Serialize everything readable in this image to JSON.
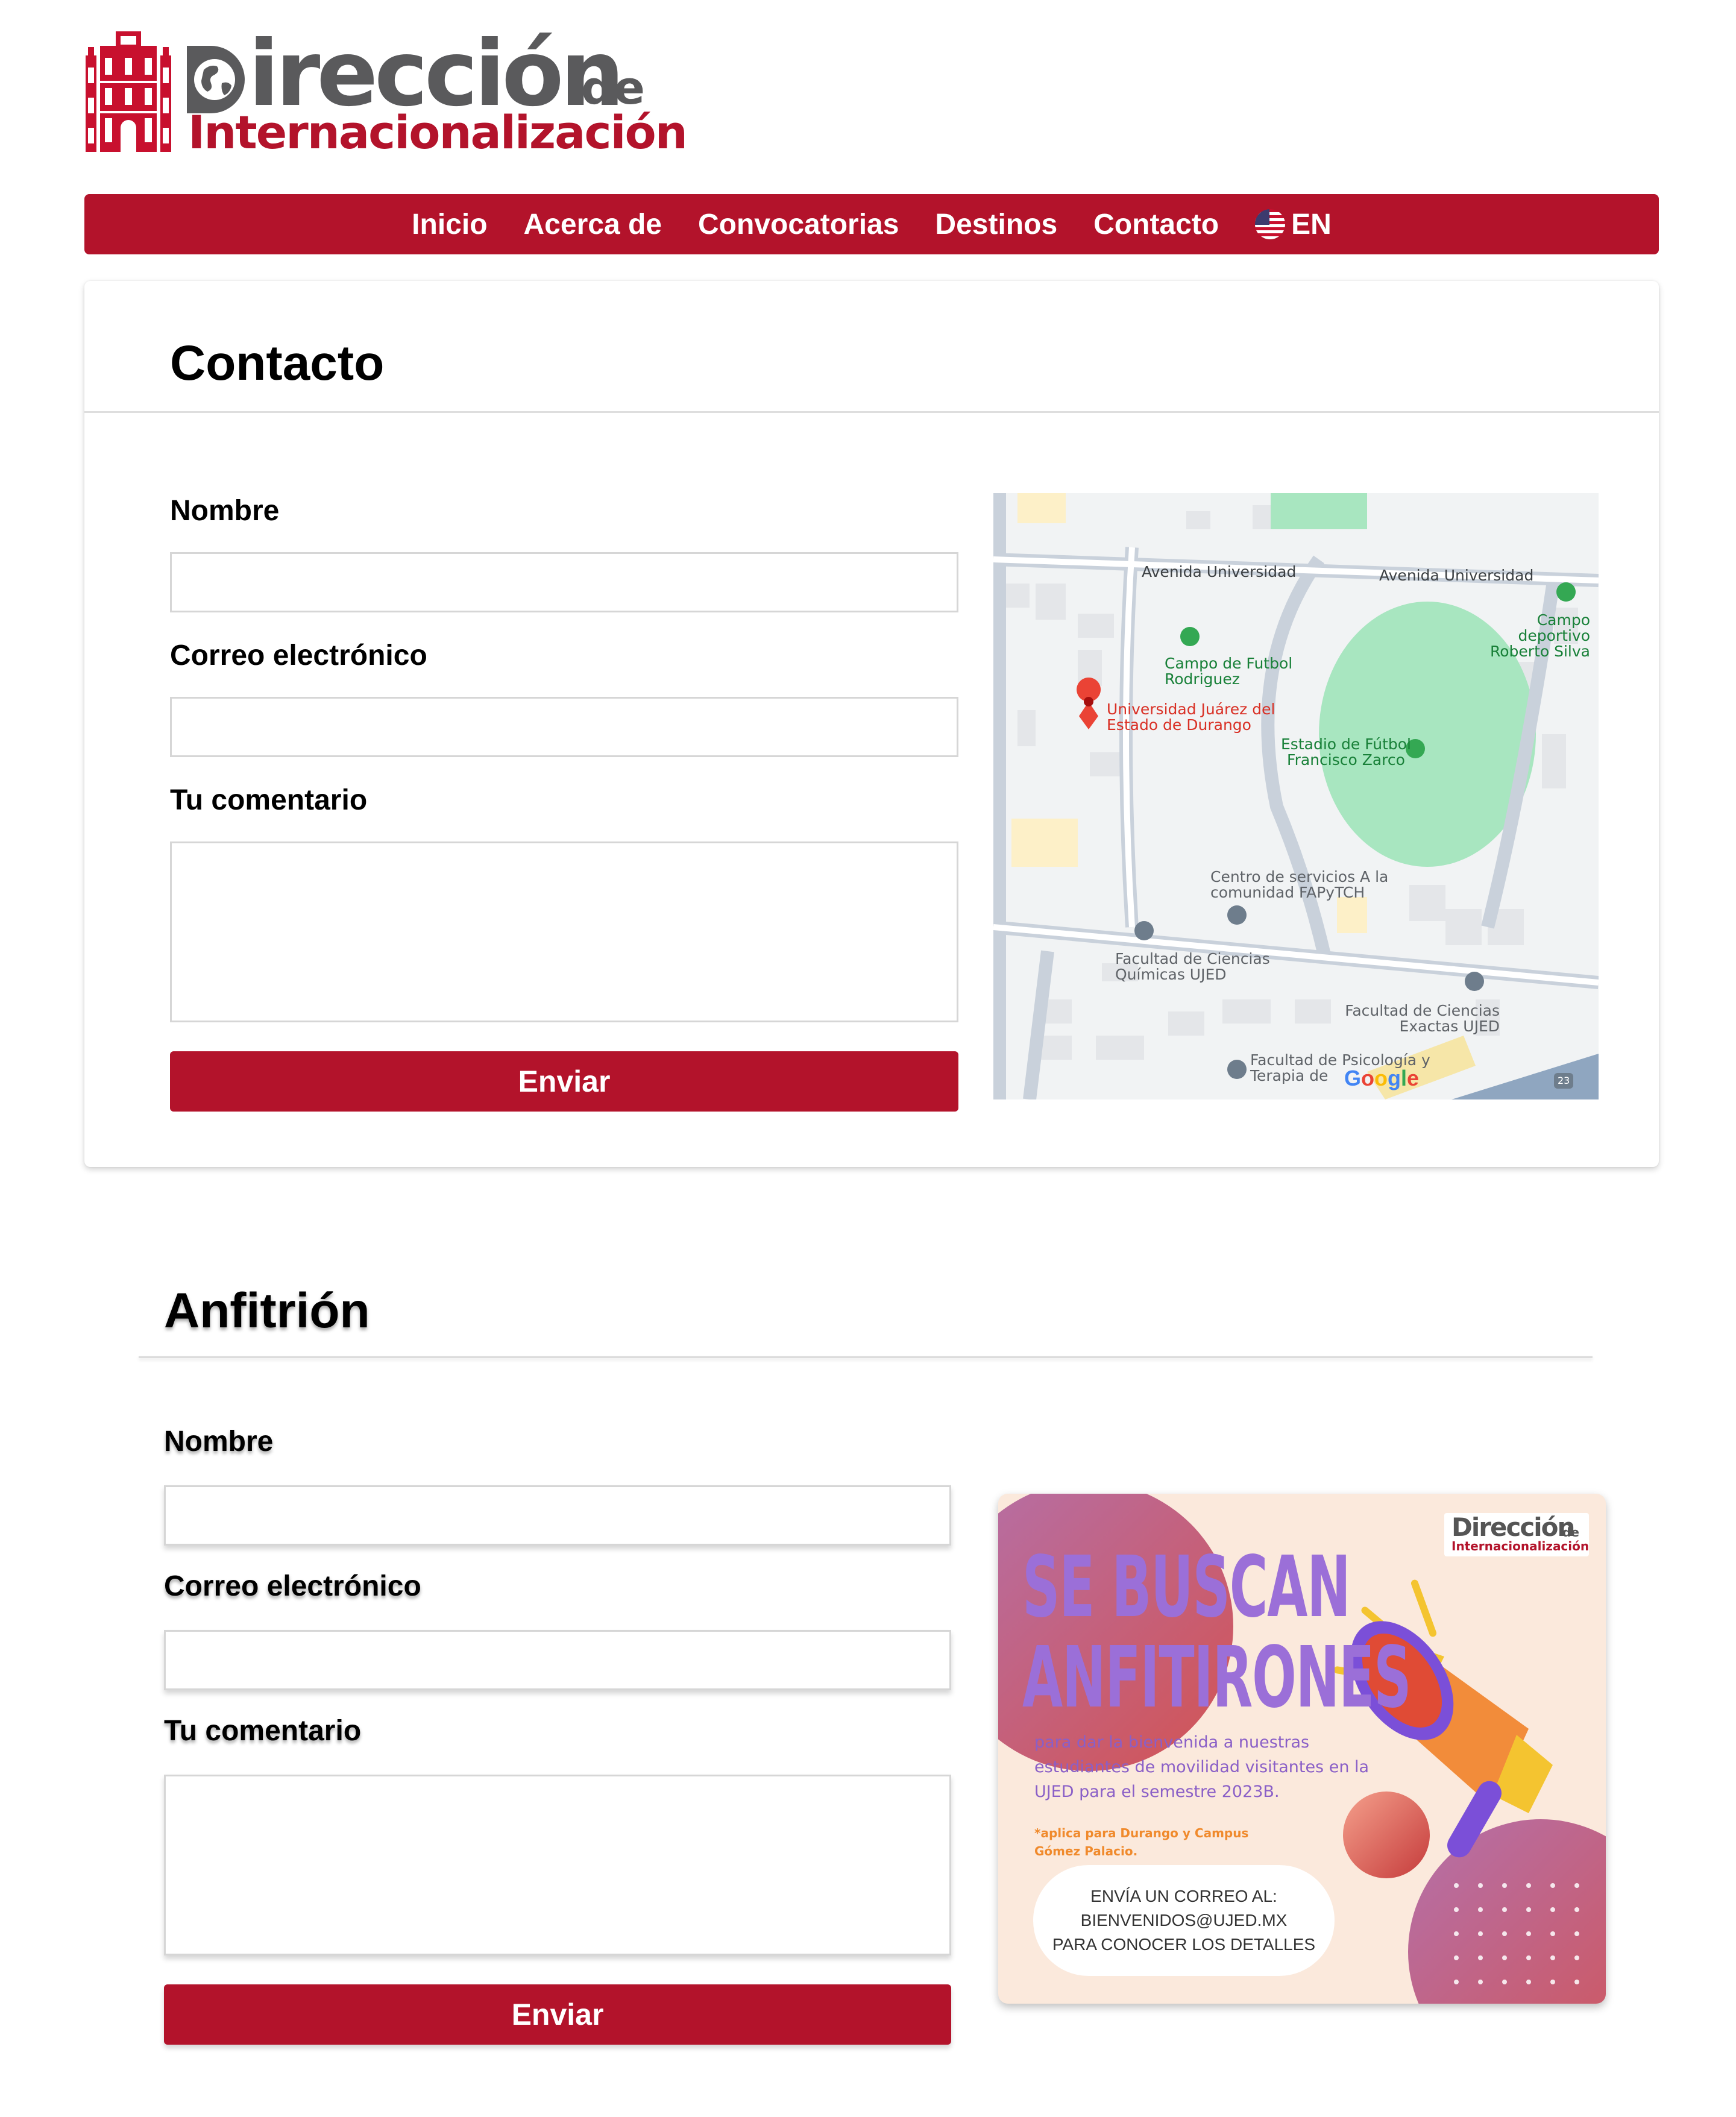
{
  "logo": {
    "line1_letter": "D",
    "line1_rest": "irección",
    "line1_de": "de",
    "line2": "Internacionalización"
  },
  "nav": {
    "items": [
      {
        "label": "Inicio"
      },
      {
        "label": "Acerca de"
      },
      {
        "label": "Convocatorias"
      },
      {
        "label": "Destinos"
      },
      {
        "label": "Contacto"
      }
    ],
    "language": "EN"
  },
  "contacto": {
    "title": "Contacto",
    "fields": {
      "nombre": {
        "label": "Nombre",
        "value": ""
      },
      "correo": {
        "label": "Correo electrónico",
        "value": ""
      },
      "comentario": {
        "label": "Tu comentario",
        "value": ""
      }
    },
    "submit": "Enviar",
    "map": {
      "streets": [
        "Avenida Universidad",
        "Avenida Universidad"
      ],
      "places": {
        "campo_deportivo": "Campo deportivo Roberto Silva",
        "campo_futbol": "Campo de Futbol Rodriguez",
        "ujed": "Universidad Juárez del Estado de Durango",
        "estadio": "Estadio de Fútbol Francisco Zarco",
        "centro_servicios": "Centro de servicios A la comunidad FAPyTCH",
        "fac_quimicas": "Facultad de Ciencias Químicas UJED",
        "fac_exactas": "Facultad de Ciencias Exactas UJED",
        "fac_psicologia": "Facultad de Psicología y Terapia de"
      },
      "road_shield": "23",
      "attribution": "Google"
    }
  },
  "anfitrion": {
    "title": "Anfitrión",
    "fields": {
      "nombre": {
        "label": "Nombre",
        "value": ""
      },
      "correo": {
        "label": "Correo electrónico",
        "value": ""
      },
      "comentario": {
        "label": "Tu comentario",
        "value": ""
      }
    },
    "submit": "Enviar",
    "poster": {
      "logo_line1": "Dirección",
      "logo_de": "de",
      "logo_line2": "Internacionalización",
      "headline_1": "SE BUSCAN",
      "headline_2": "ANFITIRONES",
      "body": "para dar la bienvenida a nuestras estudiantes de movilidad visitantes en la UJED para el semestre 2023B.",
      "note": "*aplica para Durango y Campus Gómez Palacio.",
      "cta_1": "ENVÍA UN CORREO AL:",
      "cta_2": "BIENVENIDOS@UJED.MX",
      "cta_3": "PARA CONOCER LOS DETALLES"
    }
  },
  "colors": {
    "brand_red": "#b3132b",
    "logo_gray": "#5a5a5c",
    "poster_purple": "#9b6fd8",
    "poster_bg": "#fbe9dc"
  },
  "icons": [
    "building-logo-icon",
    "globe-icon",
    "us-flag-icon",
    "map-pin-icon",
    "megaphone-illustration"
  ]
}
